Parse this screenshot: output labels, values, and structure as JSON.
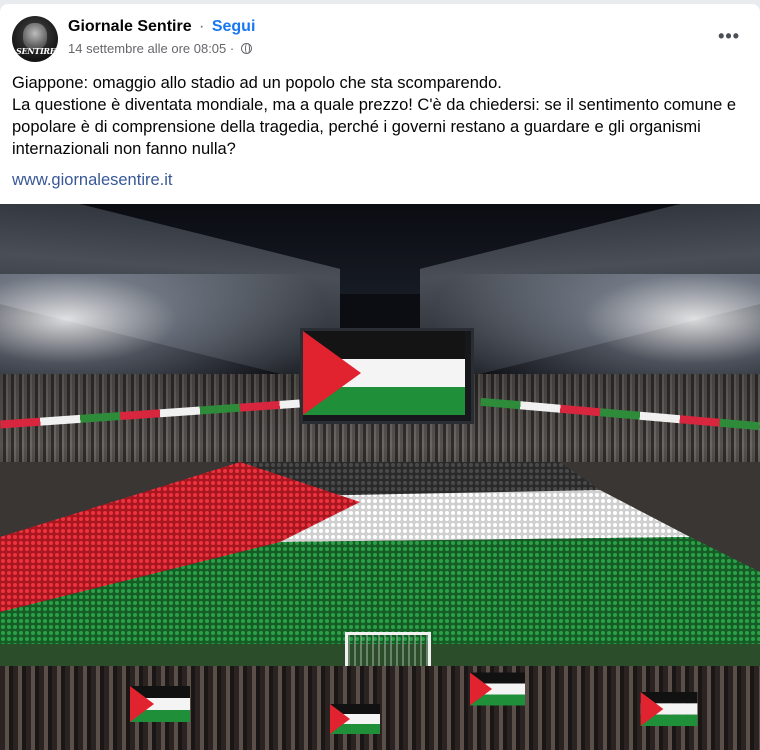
{
  "post": {
    "author": "Giornale Sentire",
    "separator": "·",
    "follow_label": "Segui",
    "timestamp": "14 settembre alle ore 08:05",
    "meta_separator": "·",
    "privacy_icon": "globe-icon",
    "more_icon": "more-options-icon",
    "more_label": "•••",
    "avatar_text": "SENTIRE",
    "text_lines": [
      "Giappone: omaggio allo stadio ad un popolo che sta scomparendo.",
      "La questione è diventata mondiale, ma a quale prezzo! C'è da chiedersi: se il sentimento comune e",
      "popolare è di comprensione della tragedia, perché i governi restano a guardare e gli organismi",
      "internazionali non fanno nulla?"
    ],
    "link": "www.giornalesentire.it"
  },
  "colors": {
    "link_blue": "#385898",
    "follow_blue": "#1877f2",
    "flag_red": "#e0232f",
    "flag_white": "#f4f4f4",
    "flag_green": "#1f8f3a",
    "flag_black": "#111111"
  }
}
